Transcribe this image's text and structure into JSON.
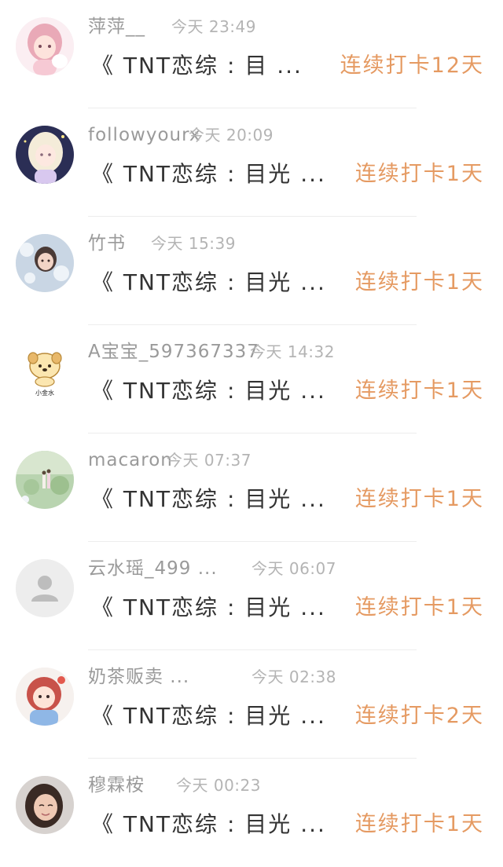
{
  "items": [
    {
      "name": "萍萍__",
      "time": "今天 23:49",
      "message": "《 TNT恋综 : 目 ...",
      "streak": "连续打卡12天",
      "avatar": "anime-girl-pink-avatar"
    },
    {
      "name": "followyourx",
      "time": "今天 20:09",
      "message": "《 TNT恋综 : 目光 ...",
      "streak": "连续打卡1天",
      "avatar": "anime-blonde-girl-avatar"
    },
    {
      "name": "竹书",
      "time": "今天 15:39",
      "message": "《 TNT恋综 : 目光 ...",
      "streak": "连续打卡1天",
      "avatar": "bubbles-girl-avatar"
    },
    {
      "name": "A宝宝_597367337",
      "time": "今天 14:32",
      "message": "《 TNT恋综 : 目光 ...",
      "streak": "连续打卡1天",
      "avatar": "cartoon-puppy-avatar",
      "avatar_caption": "小金水"
    },
    {
      "name": "macaron",
      "time": "今天 07:37",
      "message": "《 TNT恋综 : 目光 ...",
      "streak": "连续打卡1天",
      "avatar": "landscape-couple-avatar"
    },
    {
      "name": "云水瑶_499 ...",
      "time": "今天 06:07",
      "message": "《 TNT恋综 : 目光 ...",
      "streak": "连续打卡1天",
      "avatar": "default-user-avatar"
    },
    {
      "name": "奶茶贩卖 ...",
      "time": "今天 02:38",
      "message": "《 TNT恋综 : 目光 ...",
      "streak": "连续打卡2天",
      "avatar": "anime-red-hair-girl-avatar"
    },
    {
      "name": "穆霖桉",
      "time": "今天 00:23",
      "message": "《 TNT恋综 : 目光 ...",
      "streak": "连续打卡1天",
      "avatar": "selfie-girl-avatar"
    }
  ],
  "colors": {
    "streak": "#e59a62",
    "name": "#9a9a9a",
    "time": "#b4b4b4",
    "message": "#333333",
    "divider": "#ededed"
  }
}
